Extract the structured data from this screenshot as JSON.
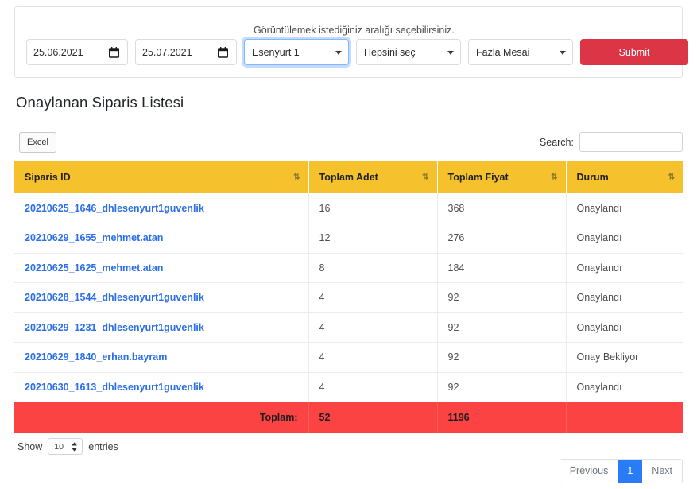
{
  "filter": {
    "hint": "Görüntülemek istediğiniz aralığı seçebilirsiniz.",
    "date_start": "25.06.2021",
    "date_end": "25.07.2021",
    "select_location": "Esenyurt 1",
    "select_all": "Hepsini seç",
    "select_type": "Fazla Mesai",
    "submit_label": "Submit",
    "submit_color": "#dc3545"
  },
  "heading": "Onaylanan Siparis Listesi",
  "toolbar": {
    "excel_label": "Excel",
    "search_label": "Search:",
    "search_value": "",
    "search_placeholder": ""
  },
  "table": {
    "header_color": "#f5c22e",
    "total_row_color": "#fc4343",
    "link_color": "#2a6ee8",
    "columns": [
      {
        "label": "Siparis ID",
        "sort": "sortable"
      },
      {
        "label": "Toplam Adet",
        "sort": "sortable"
      },
      {
        "label": "Toplam Fiyat",
        "sort": "sorted-desc"
      },
      {
        "label": "Durum",
        "sort": "sortable"
      }
    ],
    "rows": [
      {
        "id": "20210625_1646_dhlesenyurt1guvenlik",
        "adet": "16",
        "fiyat": "368",
        "durum": "Onaylandı"
      },
      {
        "id": "20210629_1655_mehmet.atan",
        "adet": "12",
        "fiyat": "276",
        "durum": "Onaylandı"
      },
      {
        "id": "20210625_1625_mehmet.atan",
        "adet": "8",
        "fiyat": "184",
        "durum": "Onaylandı"
      },
      {
        "id": "20210628_1544_dhlesenyurt1guvenlik",
        "adet": "4",
        "fiyat": "92",
        "durum": "Onaylandı"
      },
      {
        "id": "20210629_1231_dhlesenyurt1guvenlik",
        "adet": "4",
        "fiyat": "92",
        "durum": "Onaylandı"
      },
      {
        "id": "20210629_1840_erhan.bayram",
        "adet": "4",
        "fiyat": "92",
        "durum": "Onay Bekliyor"
      },
      {
        "id": "20210630_1613_dhlesenyurt1guvenlik",
        "adet": "4",
        "fiyat": "92",
        "durum": "Onaylandı"
      }
    ],
    "total": {
      "label": "Toplam:",
      "adet": "52",
      "fiyat": "1196",
      "durum": ""
    }
  },
  "footer": {
    "show_label": "Show",
    "entries_value": "10",
    "entries_label": "entries",
    "pager": {
      "previous": "Previous",
      "current_page": "1",
      "next": "Next",
      "active_color": "#2a7bf6"
    }
  }
}
